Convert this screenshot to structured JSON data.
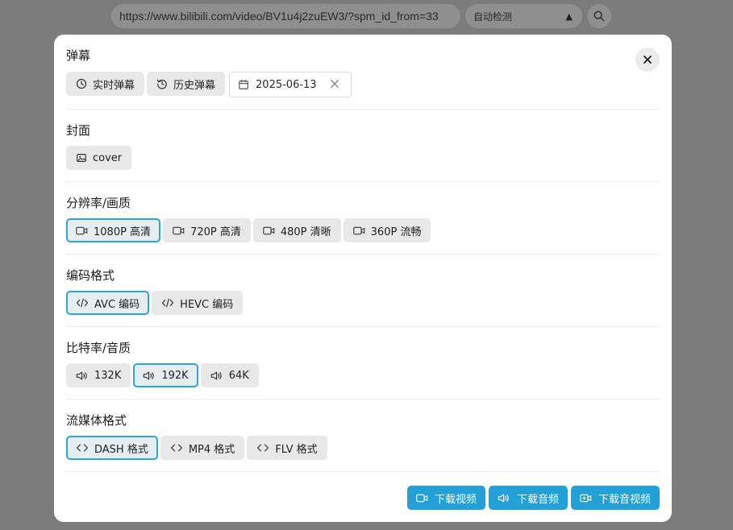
{
  "topbar": {
    "url": "https://www.bilibili.com/video/BV1u4j2zuEW3/?spm_id_from=33",
    "source_label": "自动检测"
  },
  "modal": {
    "sections": {
      "danmaku": {
        "title": "弹幕",
        "realtime_label": "实时弹幕",
        "history_label": "历史弹幕",
        "date_value": "2025-06-13"
      },
      "cover": {
        "title": "封面",
        "cover_label": "cover"
      },
      "resolution": {
        "title": "分辨率/画质",
        "options": [
          "1080P 高清",
          "720P 高清",
          "480P 清晰",
          "360P 流畅"
        ],
        "selected": "1080P 高清"
      },
      "codec": {
        "title": "编码格式",
        "options": [
          "AVC 编码",
          "HEVC 编码"
        ],
        "selected": "AVC 编码"
      },
      "bitrate": {
        "title": "比特率/音质",
        "options": [
          "132K",
          "192K",
          "64K"
        ],
        "selected": "192K"
      },
      "stream": {
        "title": "流媒体格式",
        "options": [
          "DASH 格式",
          "MP4 格式",
          "FLV 格式"
        ],
        "selected": "DASH 格式"
      }
    },
    "footer": {
      "download_video": "下载视频",
      "download_audio": "下载音频",
      "download_both": "下载音视频"
    }
  },
  "colors": {
    "accent": "#22a0d7",
    "selected_border": "#2aa6d9",
    "backdrop": "#7c7c7c"
  }
}
